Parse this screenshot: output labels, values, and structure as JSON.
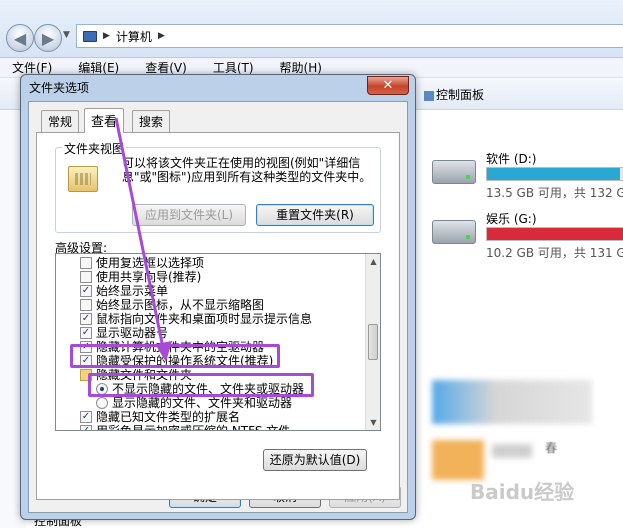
{
  "explorer": {
    "breadcrumb": "计算机",
    "menu": [
      "文件(F)",
      "编辑(E)",
      "查看(V)",
      "工具(T)",
      "帮助(H)"
    ],
    "command_right": "控制面板",
    "left_bottom": "控制面板",
    "drives": [
      {
        "name": "软件 (D:)",
        "free_text": "13.5 GB 可用，共 132 GB",
        "used_fraction": 0.9,
        "bar_color": "#2aa8d4"
      },
      {
        "name": "娱乐 (G:)",
        "free_text": "10.2 GB 可用，共 131 GB",
        "used_fraction": 0.92,
        "bar_color": "#d82a3a"
      }
    ],
    "blurred_item_label": "春"
  },
  "dialog": {
    "title": "文件夹选项",
    "close_label": "✕",
    "tabs": [
      "常规",
      "查看",
      "搜索"
    ],
    "active_tab": "查看",
    "folder_view_group": {
      "title": "文件夹视图",
      "description": "可以将该文件夹正在使用的视图(例如\"详细信息\"或\"图标\")应用到所有这种类型的文件夹中。",
      "apply_button": "应用到文件夹(L)",
      "reset_button": "重置文件夹(R)"
    },
    "advanced_label": "高级设置:",
    "advanced_items": [
      {
        "type": "checkbox",
        "checked": false,
        "indent": 0,
        "label": "使用复选框以选择项"
      },
      {
        "type": "checkbox",
        "checked": false,
        "indent": 0,
        "label": "使用共享向导(推荐)"
      },
      {
        "type": "checkbox",
        "checked": true,
        "indent": 0,
        "label": "始终显示菜单"
      },
      {
        "type": "checkbox",
        "checked": false,
        "indent": 0,
        "label": "始终显示图标，从不显示缩略图"
      },
      {
        "type": "checkbox",
        "checked": true,
        "indent": 0,
        "label": "鼠标指向文件夹和桌面项时显示提示信息"
      },
      {
        "type": "checkbox",
        "checked": true,
        "indent": 0,
        "label": "显示驱动器号"
      },
      {
        "type": "checkbox",
        "checked": true,
        "indent": 0,
        "label": "隐藏计算机文件夹中的空驱动器"
      },
      {
        "type": "checkbox",
        "checked": true,
        "indent": 0,
        "label": "隐藏受保护的操作系统文件(推荐)"
      },
      {
        "type": "folder",
        "checked": false,
        "indent": 0,
        "label": "隐藏文件和文件夹"
      },
      {
        "type": "radio",
        "checked": true,
        "indent": 1,
        "label": "不显示隐藏的文件、文件夹或驱动器"
      },
      {
        "type": "radio",
        "checked": false,
        "indent": 1,
        "label": "显示隐藏的文件、文件夹和驱动器"
      },
      {
        "type": "checkbox",
        "checked": true,
        "indent": 0,
        "label": "隐藏已知文件类型的扩展名"
      },
      {
        "type": "checkbox",
        "checked": true,
        "indent": 0,
        "label": "用彩色显示加密或压缩的 NTFS 文件"
      }
    ],
    "restore_button": "还原为默认值(D)",
    "ok_button": "确定",
    "cancel_button": "取消",
    "apply_button": "应用(A)"
  },
  "watermark": "Baidu经验",
  "colors": {
    "highlight": "#a64bd8"
  }
}
